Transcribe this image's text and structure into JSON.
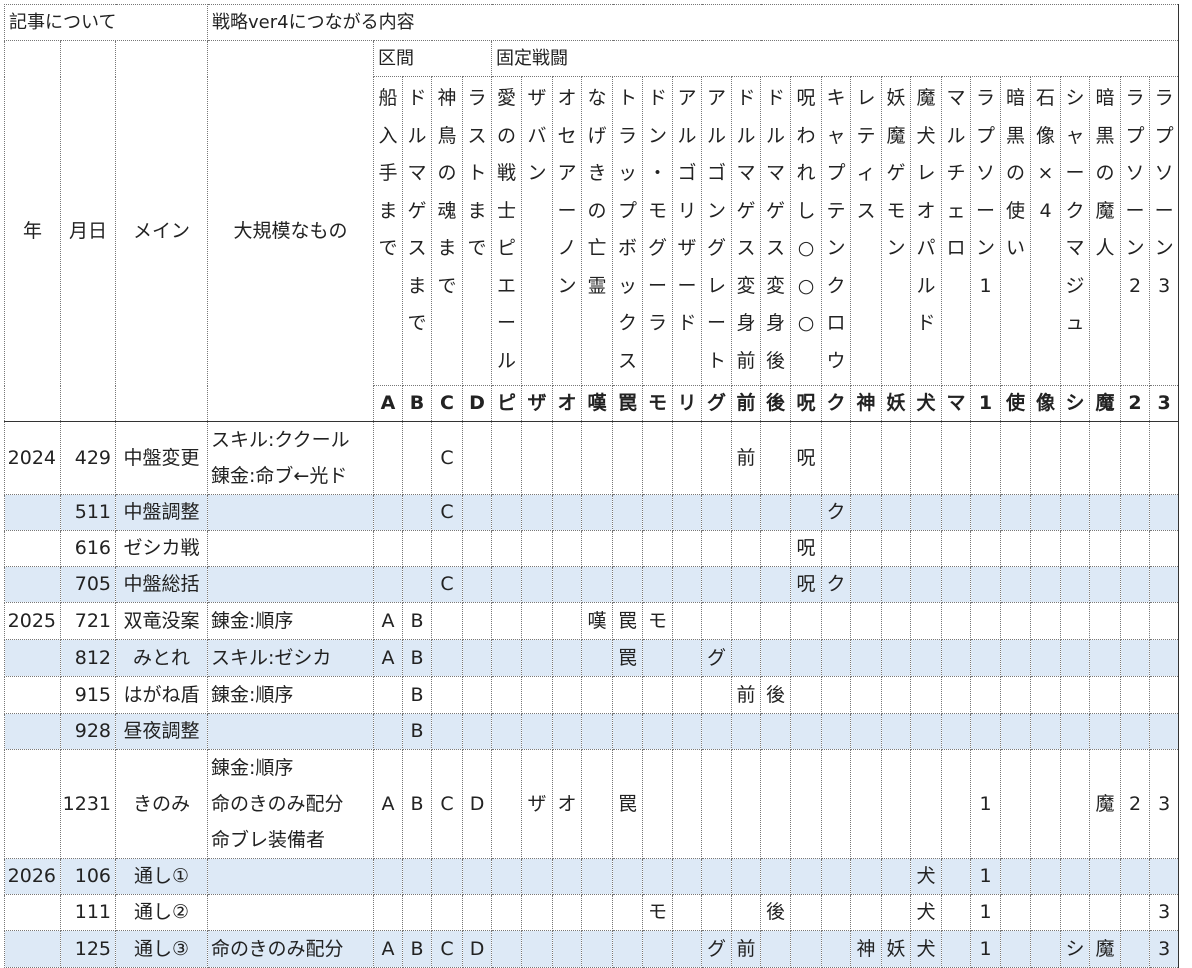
{
  "sections": {
    "about": "記事について",
    "strategy": "戦略ver4につながる内容",
    "kukan": "区間",
    "fixed_battles": "固定戦闘"
  },
  "headers": {
    "year": "年",
    "date": "月日",
    "main": "メイン",
    "large": "大規模なもの"
  },
  "columns": [
    {
      "name": "船入手まで",
      "abbr": "A"
    },
    {
      "name": "ドルマゲスまで",
      "abbr": "B"
    },
    {
      "name": "神鳥の魂まで",
      "abbr": "C"
    },
    {
      "name": "ラストまで",
      "abbr": "D"
    },
    {
      "name": "愛の戦士ピエール",
      "abbr": "ピ"
    },
    {
      "name": "ザバン",
      "abbr": "ザ"
    },
    {
      "name": "オセアーノン",
      "abbr": "オ"
    },
    {
      "name": "なげきの亡霊",
      "abbr": "嘆"
    },
    {
      "name": "トラップボックス",
      "abbr": "罠"
    },
    {
      "name": "ドン・モグーラ",
      "abbr": "モ"
    },
    {
      "name": "アルゴリザード",
      "abbr": "リ"
    },
    {
      "name": "アルゴングレート",
      "abbr": "グ"
    },
    {
      "name": "ドルマゲス変身前",
      "abbr": "前"
    },
    {
      "name": "ドルマゲス変身後",
      "abbr": "後"
    },
    {
      "name": "呪われし○○○",
      "abbr": "呪"
    },
    {
      "name": "キャプテンクロウ",
      "abbr": "ク"
    },
    {
      "name": "レティス",
      "abbr": "神"
    },
    {
      "name": "妖魔ゲモン",
      "abbr": "妖"
    },
    {
      "name": "魔犬レオパルド",
      "abbr": "犬"
    },
    {
      "name": "マルチェロ",
      "abbr": "マ"
    },
    {
      "name": "ラプソーン1",
      "abbr": "1"
    },
    {
      "name": "暗黒の使い",
      "abbr": "使"
    },
    {
      "name": "石像×4",
      "abbr": "像"
    },
    {
      "name": "シャークマジュ",
      "abbr": "シ"
    },
    {
      "name": "暗黒の魔人",
      "abbr": "魔"
    },
    {
      "name": "ラプソーン2",
      "abbr": "2"
    },
    {
      "name": "ラプソーン3",
      "abbr": "3"
    }
  ],
  "rows": [
    {
      "year": "2024",
      "date": "429",
      "main": "中盤変更",
      "large": [
        "スキル:ククール",
        "錬金:命ブ←光ド"
      ],
      "marks": [
        "",
        "",
        "C",
        "",
        "",
        "",
        "",
        "",
        "",
        "",
        "",
        "",
        "前",
        "",
        "呪",
        "",
        "",
        "",
        "",
        "",
        "",
        "",
        "",
        "",
        "",
        "",
        ""
      ]
    },
    {
      "year": "",
      "date": "511",
      "main": "中盤調整",
      "large": [],
      "marks": [
        "",
        "",
        "C",
        "",
        "",
        "",
        "",
        "",
        "",
        "",
        "",
        "",
        "",
        "",
        "",
        "ク",
        "",
        "",
        "",
        "",
        "",
        "",
        "",
        "",
        "",
        "",
        ""
      ]
    },
    {
      "year": "",
      "date": "616",
      "main": "ゼシカ戦",
      "large": [],
      "marks": [
        "",
        "",
        "",
        "",
        "",
        "",
        "",
        "",
        "",
        "",
        "",
        "",
        "",
        "",
        "呪",
        "",
        "",
        "",
        "",
        "",
        "",
        "",
        "",
        "",
        "",
        "",
        ""
      ]
    },
    {
      "year": "",
      "date": "705",
      "main": "中盤総括",
      "large": [],
      "marks": [
        "",
        "",
        "C",
        "",
        "",
        "",
        "",
        "",
        "",
        "",
        "",
        "",
        "",
        "",
        "呪",
        "ク",
        "",
        "",
        "",
        "",
        "",
        "",
        "",
        "",
        "",
        "",
        ""
      ]
    },
    {
      "year": "2025",
      "date": "721",
      "main": "双竜没案",
      "large": [
        "錬金:順序"
      ],
      "marks": [
        "A",
        "B",
        "",
        "",
        "",
        "",
        "",
        "嘆",
        "罠",
        "モ",
        "",
        "",
        "",
        "",
        "",
        "",
        "",
        "",
        "",
        "",
        "",
        "",
        "",
        "",
        "",
        "",
        ""
      ]
    },
    {
      "year": "",
      "date": "812",
      "main": "みとれ",
      "large": [
        "スキル:ゼシカ"
      ],
      "marks": [
        "A",
        "B",
        "",
        "",
        "",
        "",
        "",
        "",
        "罠",
        "",
        "",
        "グ",
        "",
        "",
        "",
        "",
        "",
        "",
        "",
        "",
        "",
        "",
        "",
        "",
        "",
        "",
        ""
      ]
    },
    {
      "year": "",
      "date": "915",
      "main": "はがね盾",
      "large": [
        "錬金:順序"
      ],
      "marks": [
        "",
        "B",
        "",
        "",
        "",
        "",
        "",
        "",
        "",
        "",
        "",
        "",
        "前",
        "後",
        "",
        "",
        "",
        "",
        "",
        "",
        "",
        "",
        "",
        "",
        "",
        "",
        ""
      ]
    },
    {
      "year": "",
      "date": "928",
      "main": "昼夜調整",
      "large": [],
      "marks": [
        "",
        "B",
        "",
        "",
        "",
        "",
        "",
        "",
        "",
        "",
        "",
        "",
        "",
        "",
        "",
        "",
        "",
        "",
        "",
        "",
        "",
        "",
        "",
        "",
        "",
        "",
        ""
      ]
    },
    {
      "year": "",
      "date": "1231",
      "main": "きのみ",
      "large": [
        "錬金:順序",
        "命のきのみ配分",
        "命ブレ装備者"
      ],
      "marks": [
        "A",
        "B",
        "C",
        "D",
        "",
        "ザ",
        "オ",
        "",
        "罠",
        "",
        "",
        "",
        "",
        "",
        "",
        "",
        "",
        "",
        "",
        "",
        "1",
        "",
        "",
        "",
        "魔",
        "2",
        "3"
      ]
    },
    {
      "year": "2026",
      "date": "106",
      "main": "通し①",
      "large": [],
      "marks": [
        "",
        "",
        "",
        "",
        "",
        "",
        "",
        "",
        "",
        "",
        "",
        "",
        "",
        "",
        "",
        "",
        "",
        "",
        "犬",
        "",
        "1",
        "",
        "",
        "",
        "",
        "",
        ""
      ]
    },
    {
      "year": "",
      "date": "111",
      "main": "通し②",
      "large": [],
      "marks": [
        "",
        "",
        "",
        "",
        "",
        "",
        "",
        "",
        "",
        "モ",
        "",
        "",
        "",
        "後",
        "",
        "",
        "",
        "",
        "犬",
        "",
        "1",
        "",
        "",
        "",
        "",
        "",
        "3"
      ]
    },
    {
      "year": "",
      "date": "125",
      "main": "通し③",
      "large": [
        "命のきのみ配分"
      ],
      "marks": [
        "A",
        "B",
        "C",
        "D",
        "",
        "",
        "",
        "",
        "",
        "",
        "",
        "グ",
        "前",
        "",
        "",
        "",
        "神",
        "妖",
        "犬",
        "",
        "1",
        "",
        "",
        "シ",
        "魔",
        "",
        "3"
      ]
    }
  ]
}
